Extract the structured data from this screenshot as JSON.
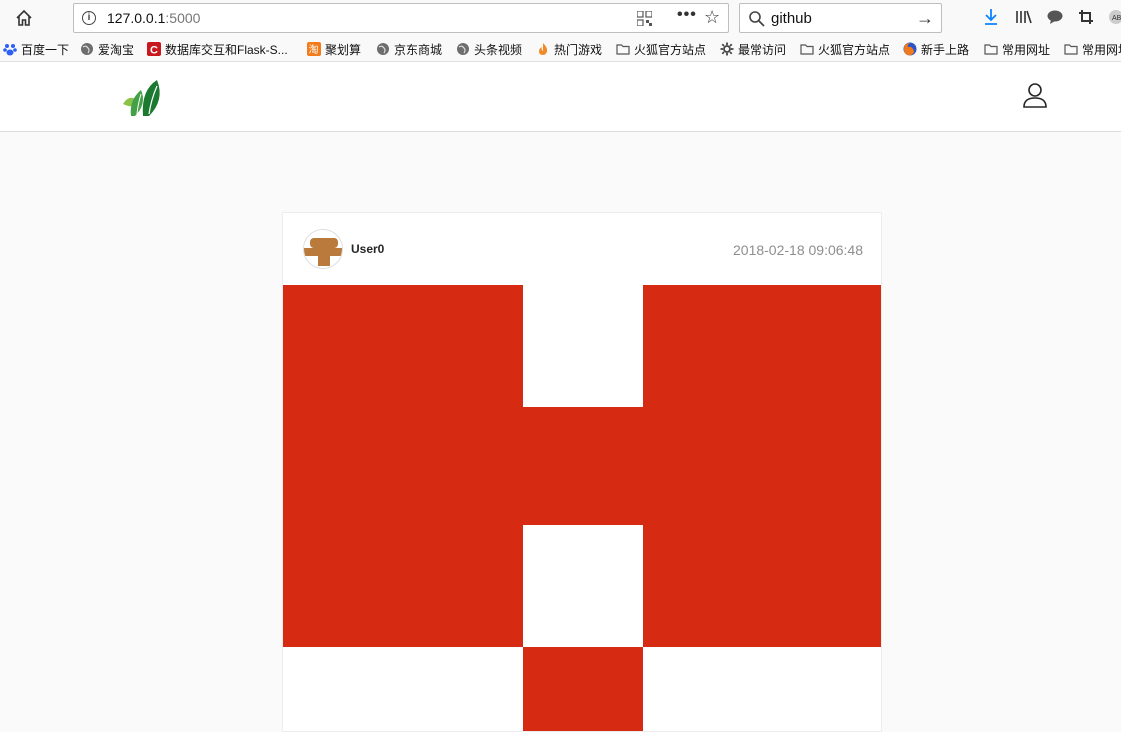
{
  "browser": {
    "url_host": "127.0.0.1",
    "url_port": ":5000",
    "search_query": "github"
  },
  "bookmarks": [
    {
      "label": "百度一下",
      "icon": "baidu-icon"
    },
    {
      "label": "爱淘宝",
      "icon": "globe-icon"
    },
    {
      "label": "数据库交互和Flask-S...",
      "icon": "csdn-icon"
    },
    {
      "label": "聚划算",
      "icon": "taobao-icon"
    },
    {
      "label": "京东商城",
      "icon": "globe-icon"
    },
    {
      "label": "头条视频",
      "icon": "globe-icon"
    },
    {
      "label": "热门游戏",
      "icon": "flame-icon"
    },
    {
      "label": "火狐官方站点",
      "icon": "folder-icon"
    },
    {
      "label": "最常访问",
      "icon": "gear-icon"
    },
    {
      "label": "火狐官方站点",
      "icon": "folder-icon"
    },
    {
      "label": "新手上路",
      "icon": "firefox-icon"
    },
    {
      "label": "常用网址",
      "icon": "folder-icon"
    },
    {
      "label": "常用网址",
      "icon": "folder-icon"
    }
  ],
  "post": {
    "username": "User0",
    "time": "2018-02-18 09:06:48",
    "image_colors": {
      "primary": "#d72a13",
      "secondary": "#ffffff"
    },
    "avatar_color": "#b97a3c"
  }
}
